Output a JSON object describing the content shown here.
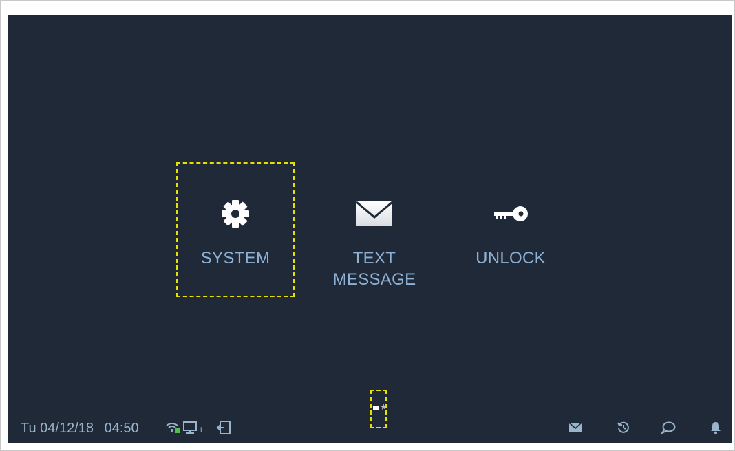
{
  "tiles": [
    {
      "label": "SYSTEM",
      "icon": "gear-icon"
    },
    {
      "label": "TEXT\nMESSAGE",
      "icon": "envelope-icon"
    },
    {
      "label": "UNLOCK",
      "icon": "key-icon"
    }
  ],
  "status_bar": {
    "day": "Tu",
    "date": "04/12/18",
    "time": "04:50",
    "monitor_count": "1",
    "left_icons": [
      "wifi-icon",
      "monitor-icon",
      "exit-icon"
    ],
    "right_icons": [
      "mail-icon",
      "history-icon",
      "chat-icon",
      "bell-icon"
    ]
  },
  "pager": {
    "pages": 2,
    "current": 1,
    "icon": "star-icon"
  },
  "colors": {
    "background": "#1f2937",
    "label": "#8fb2d4",
    "focus": "#e8e000",
    "icon": "#ffffff"
  }
}
